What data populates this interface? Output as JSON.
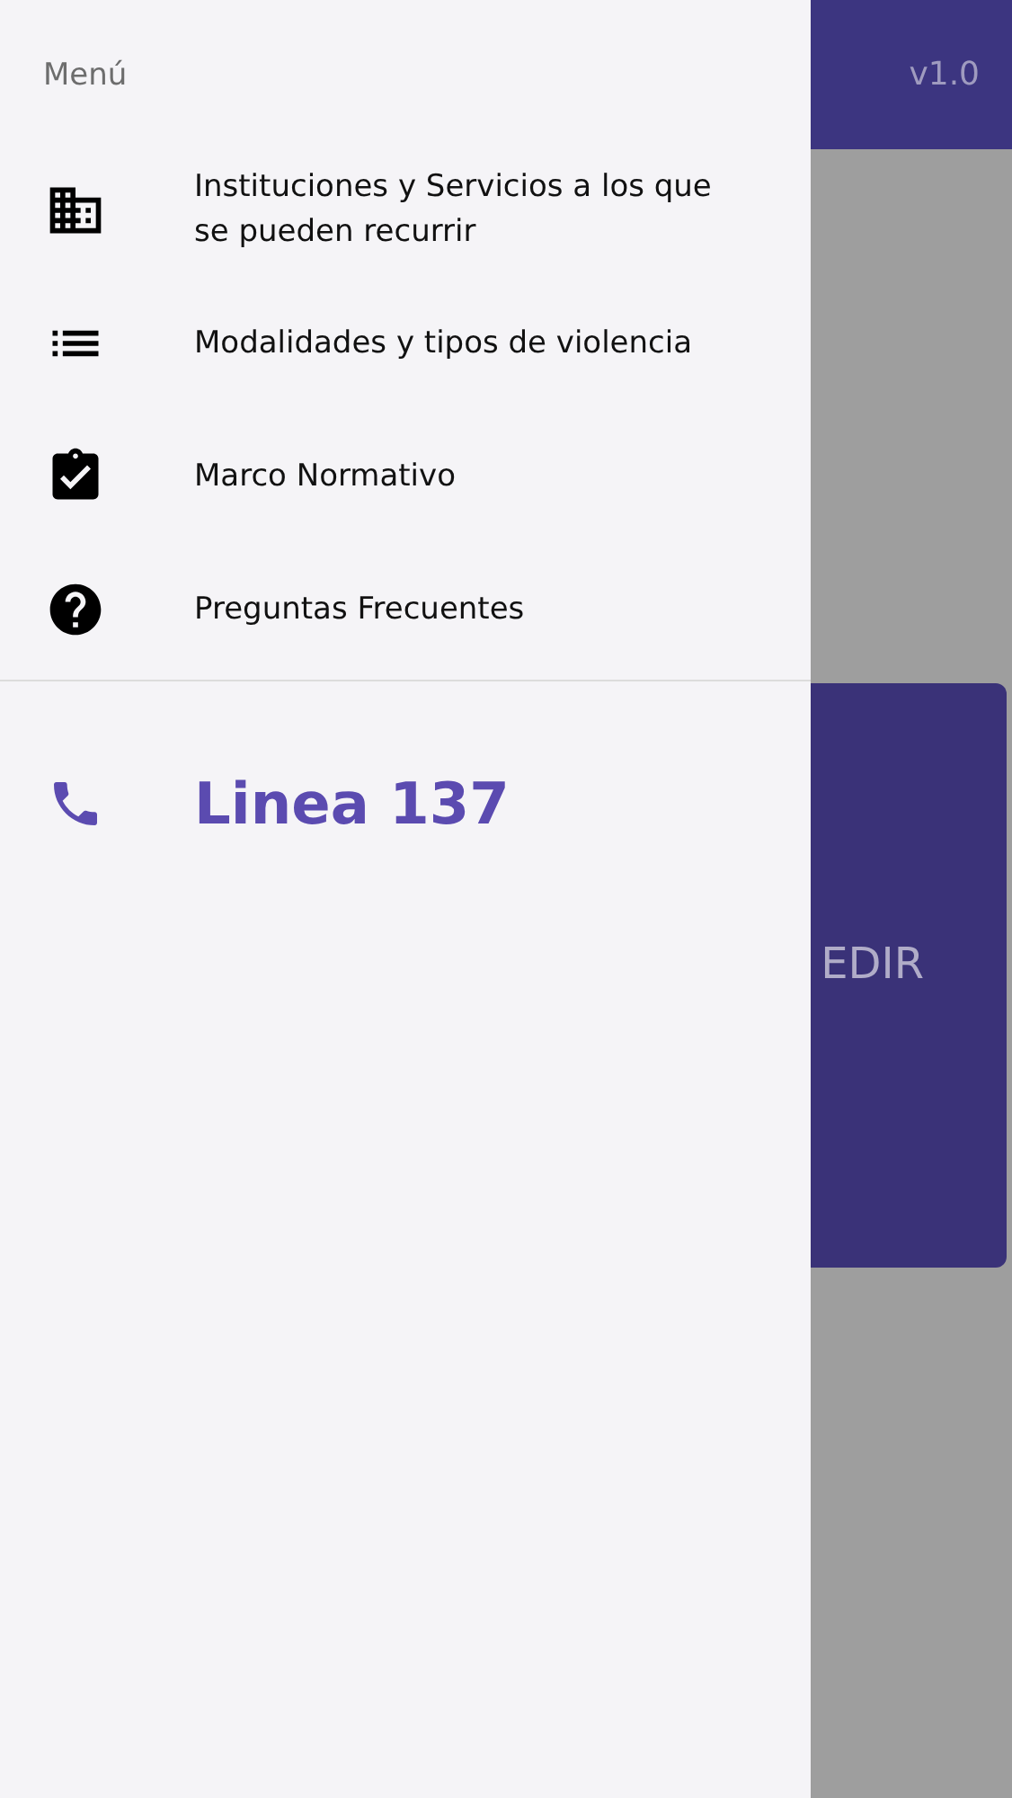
{
  "app_bar": {
    "version": "v1.0"
  },
  "card": {
    "label": "EDIR"
  },
  "drawer": {
    "title": "Menú",
    "items": [
      {
        "kind": "building",
        "label": "Instituciones y Servicios a los que se pueden recurrir"
      },
      {
        "kind": "list",
        "label": "Modalidades y tipos de violencia"
      },
      {
        "kind": "clipboard",
        "label": "Marco Normativo"
      },
      {
        "kind": "help",
        "label": "Preguntas Frecuentes"
      }
    ],
    "hotline": {
      "label": "Linea 137"
    }
  }
}
